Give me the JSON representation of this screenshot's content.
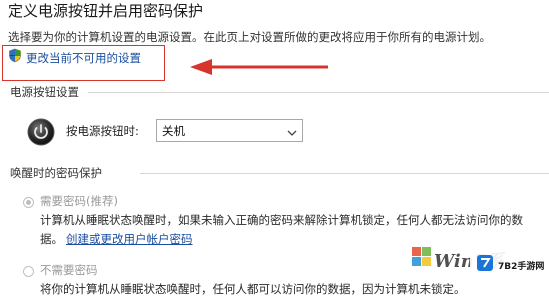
{
  "page": {
    "title": "定义电源按钮并启用密码保护",
    "subtitle": "选择要为你的计算机设置的电源设置。在此页上对设置所做的更改将应用于你所有的电源计划。",
    "change_settings_link": "更改当前不可用的设置"
  },
  "power_buttons": {
    "section_title": "电源按钮设置",
    "label": "按电源按钮时:",
    "selected": "关机"
  },
  "wake_password": {
    "section_title": "唤醒时的密码保护",
    "options": [
      {
        "label": "需要密码(推荐)",
        "selected": true,
        "desc_line1": "计算机从睡眠状态唤醒时，如果未输入正确的密码来解除计算机锁定，任何人都无法访问你的数",
        "desc_line2": "据。",
        "link": "创建或更改用户帐户密码"
      },
      {
        "label": "不需要密码",
        "selected": false,
        "desc_line1": "将你的计算机从睡眠状态唤醒时，任何人都可以访问你的数据，因为计算机未锁定。"
      }
    ]
  },
  "watermark": {
    "text": "Win7系",
    "badge_text": "7B2手游网"
  },
  "colors": {
    "accent_link": "#1a4ea0",
    "highlight_red": "#d8342c"
  }
}
